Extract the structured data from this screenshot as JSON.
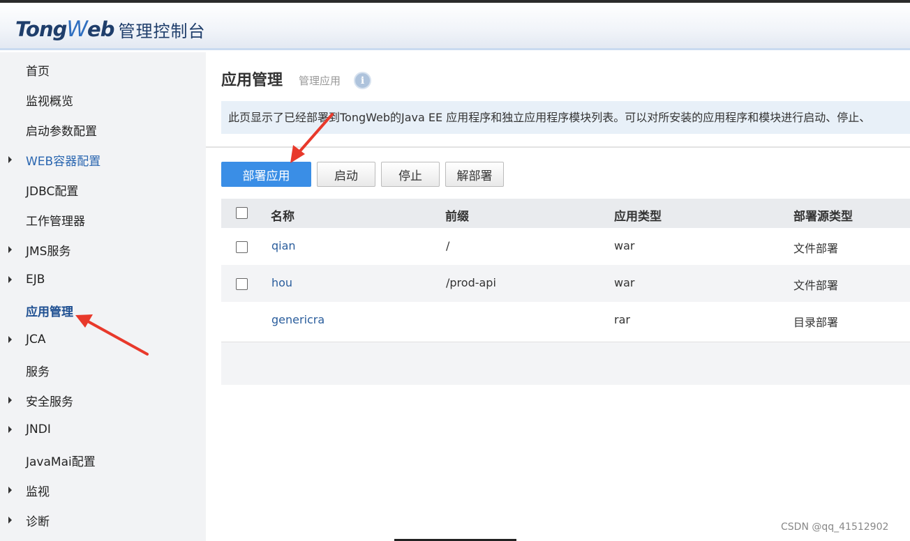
{
  "header": {
    "logo_brand_a": "Tong",
    "logo_brand_w": "W",
    "logo_brand_b": "eb",
    "logo_sub": "管理控制台"
  },
  "sidebar": {
    "items": [
      {
        "label": "首页",
        "expandable": false
      },
      {
        "label": "监视概览",
        "expandable": false
      },
      {
        "label": "启动参数配置",
        "expandable": false
      },
      {
        "label": "WEB容器配置",
        "expandable": true
      },
      {
        "label": "JDBC配置",
        "expandable": false
      },
      {
        "label": "工作管理器",
        "expandable": false
      },
      {
        "label": "JMS服务",
        "expandable": true
      },
      {
        "label": "EJB",
        "expandable": true
      },
      {
        "label": "应用管理",
        "expandable": false,
        "active": true
      },
      {
        "label": "JCA",
        "expandable": true
      },
      {
        "label": "服务",
        "expandable": false
      },
      {
        "label": "安全服务",
        "expandable": true
      },
      {
        "label": "JNDI",
        "expandable": true
      },
      {
        "label": "JavaMai配置",
        "expandable": false
      },
      {
        "label": "监视",
        "expandable": true
      },
      {
        "label": "诊断",
        "expandable": true
      }
    ]
  },
  "main": {
    "title": "应用管理",
    "subtitle": "管理应用",
    "info_icon": "i",
    "description": "此页显示了已经部署到TongWeb的Java EE 应用程序和独立应用程序模块列表。可以对所安装的应用程序和模块进行启动、停止、",
    "buttons": {
      "deploy": "部署应用",
      "start": "启动",
      "stop": "停止",
      "undeploy": "解部署"
    },
    "table": {
      "headers": [
        "名称",
        "前缀",
        "应用类型",
        "部署源类型"
      ],
      "rows": [
        {
          "name": "qian",
          "prefix": "/",
          "type": "war",
          "source": "文件部署",
          "checkbox": true
        },
        {
          "name": "hou",
          "prefix": "/prod-api",
          "type": "war",
          "source": "文件部署",
          "checkbox": true
        },
        {
          "name": "genericra",
          "prefix": "",
          "type": "rar",
          "source": "目录部署",
          "checkbox": false
        }
      ]
    }
  },
  "watermark": "CSDN @qq_41512902",
  "colors": {
    "primary_button": "#3a8ee6",
    "link": "#2a5d9c",
    "annotation_arrow": "#e8392b",
    "sidebar_bg": "#f2f3f5"
  }
}
